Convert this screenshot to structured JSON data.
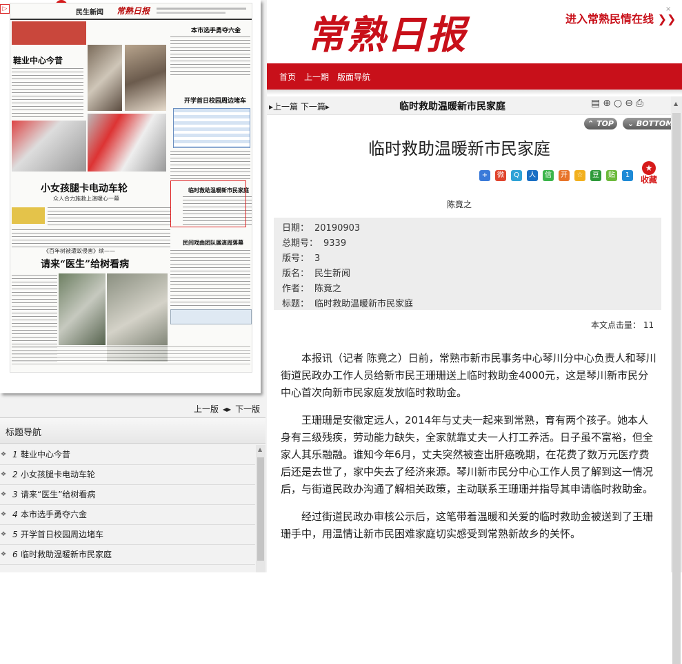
{
  "left_panel": {
    "favorite_label": "收藏",
    "paper": {
      "section_label": "民生新闻",
      "brand": "常熟日报",
      "headline_1": "鞋业中心今昔",
      "headline_2": "小女孩腿卡电动车轮",
      "headline_2_sub": "众人合力施救上演暖心一幕",
      "headline_3_pre": "《百年树被遭蚁侵害》续——",
      "headline_3": "请来“医生”给树看病",
      "col_title_1": "本市选手勇夺六金",
      "col_title_2": "开学首日校园周边堵车",
      "col_title_3": "临时救助温暖新市民家庭",
      "col_title_4": "民间戏曲团队展演周落幕"
    },
    "pager": {
      "prev": "上一版",
      "next": "下一版"
    },
    "nav": {
      "heading": "标题导航",
      "items": [
        {
          "num": "1",
          "title": "鞋业中心今昔"
        },
        {
          "num": "2",
          "title": "小女孩腿卡电动车轮"
        },
        {
          "num": "3",
          "title": "请来“医生”给树看病"
        },
        {
          "num": "4",
          "title": "本市选手勇夺六金"
        },
        {
          "num": "5",
          "title": "开学首日校园周边堵车"
        },
        {
          "num": "6",
          "title": "临时救助温暖新市民家庭"
        }
      ]
    }
  },
  "header": {
    "logo_text": "常熟日报",
    "minqing_link": "进入常熟民情在线 ❯❯",
    "menu": [
      "首页",
      "上一期",
      "版面导航"
    ]
  },
  "toolbar": {
    "prev": "上一篇",
    "next": "下一篇",
    "title": "临时救助温暖新市民家庭",
    "top_btn": "TOP",
    "bottom_btn": "BOTTOM"
  },
  "article": {
    "headline": "临时救助温暖新市民家庭",
    "favorite_label": "收藏",
    "author": "陈竟之",
    "meta": [
      {
        "label": "日期：",
        "value": "20190903"
      },
      {
        "label": "总期号：",
        "value": "9339"
      },
      {
        "label": "版号：",
        "value": "3"
      },
      {
        "label": "版名：",
        "value": "民生新闻"
      },
      {
        "label": "作者：",
        "value": "陈竟之"
      },
      {
        "label": "标题：",
        "value": "临时救助温暖新市民家庭"
      }
    ],
    "word_count": "本文点击量： 11",
    "paragraphs": [
      "本报讯（记者 陈竟之）日前，常熟市新市民事务中心琴川分中心负责人和琴川街道民政办工作人员给新市民王珊珊送上临时救助金4000元，这是琴川新市民分中心首次向新市民家庭发放临时救助金。",
      "王珊珊是安徽定远人，2014年与丈夫一起来到常熟，育有两个孩子。她本人身有三级残疾，劳动能力缺失，全家就靠丈夫一人打工养活。日子虽不富裕，但全家人其乐融融。谁知今年6月，丈夫突然被查出肝癌晚期，在花费了数万元医疗费后还是去世了，家中失去了经济来源。琴川新市民分中心工作人员了解到这一情况后，与街道民政办沟通了解相关政策，主动联系王珊珊并指导其申请临时救助金。",
      "经过街道民政办审核公示后，这笔带着温暖和关爱的临时救助金被送到了王珊珊手中，用温情让新市民困难家庭切实感受到常熟新故乡的关怀。"
    ]
  },
  "colors": {
    "brand_red": "#c8101a"
  },
  "icons": [
    "plus-icon",
    "weibo-icon",
    "qzone-icon",
    "renren-icon",
    "wechat-icon",
    "kaixin-icon",
    "star-icon",
    "douban-icon",
    "tieba-icon",
    "more-icon"
  ]
}
